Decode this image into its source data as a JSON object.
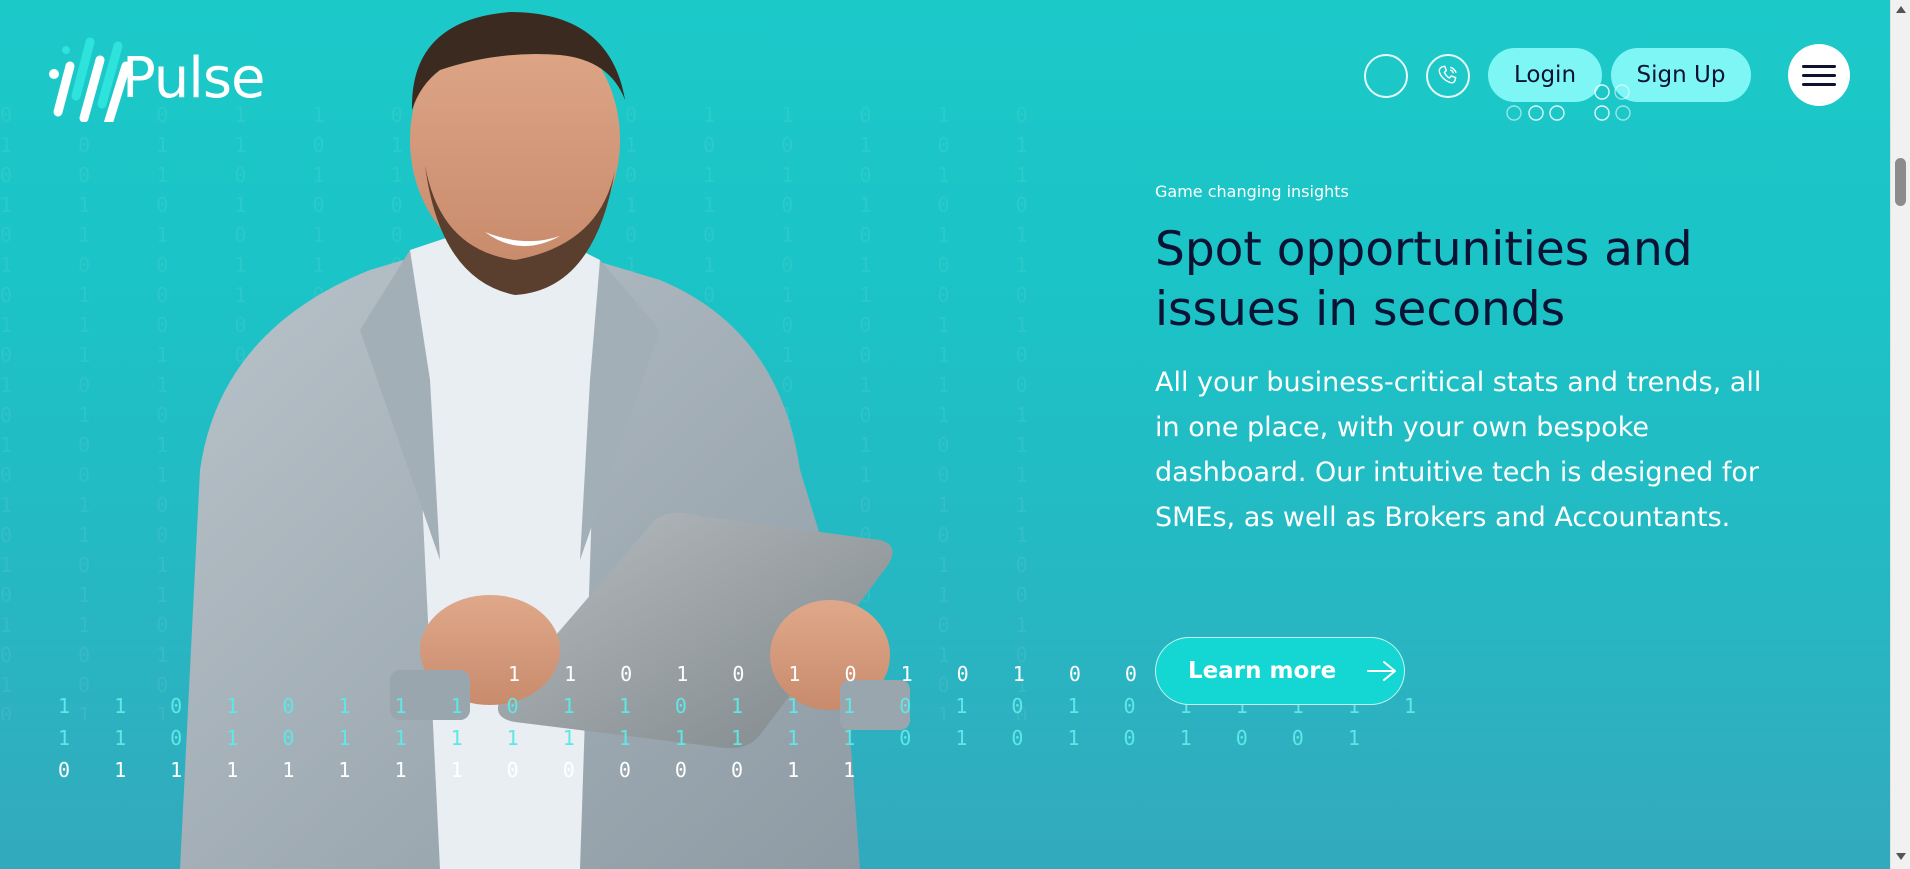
{
  "brand": {
    "name": "Pulse"
  },
  "header": {
    "login_label": "Login",
    "signup_label": "Sign Up",
    "search_icon": "circle-icon",
    "phone_icon": "phone-icon",
    "menu_icon": "hamburger-menu-icon"
  },
  "hero": {
    "eyebrow": "Game changing insights",
    "headline": "Spot opportunities and issues in seconds",
    "body": "All your business-critical stats and trends, all in one place, with your own bespoke dashboard. Our intuitive tech is designed for SMEs, as well as Brokers and Accountants.",
    "cta_label": "Learn more",
    "cta_icon": "arrow-right-icon"
  },
  "binary_stream": {
    "line1": "1 1 0 1 0 1 0 1 0 1 0 0 0",
    "line2": "1 1 0 1 0 1 1 1 0 1 1 0 1 1 1 0 1 0 1 0 1 1 1 1 1",
    "line3": "1 1 0 1 0 1 1 1 1 1 1 1 1 1 1 0 1 0 1 0 1 0 0 1",
    "line4": "0 1 1 1 1 1 1 1 0 0 0 0 0 1 1"
  },
  "colors": {
    "background_top": "#1cc9c9",
    "background_bottom": "#33a9bd",
    "headline": "#0c1233",
    "button_light": "#7ff6f6",
    "cta": "#14d6d3"
  }
}
